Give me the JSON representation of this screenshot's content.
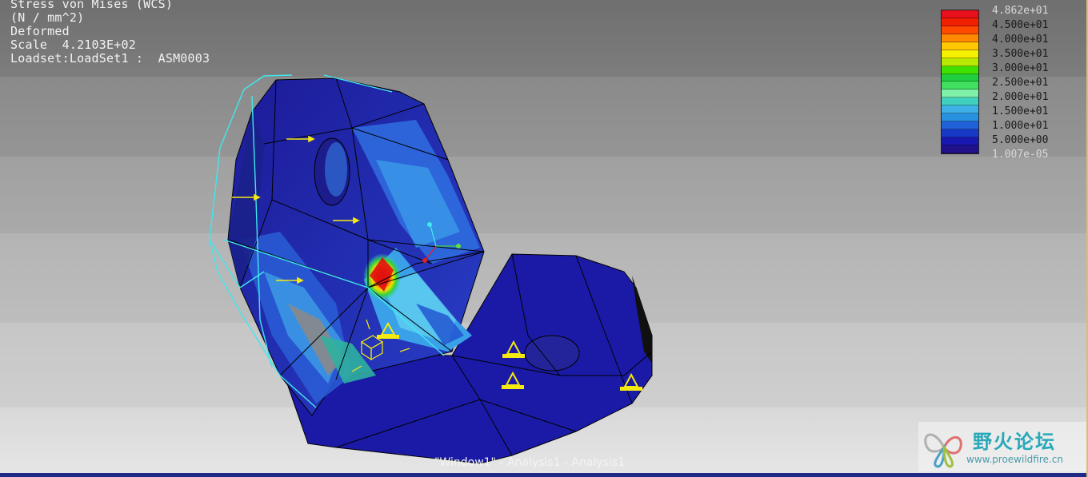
{
  "result_header": {
    "line1": "Stress von Mises (WCS)",
    "line2": "(N / mm^2)",
    "line3": "Deformed",
    "line4": "Scale  4.2103E+02",
    "line5": "Loadset:LoadSet1 :  ASM0003"
  },
  "legend": {
    "labels": [
      "4.862e+01",
      "4.500e+01",
      "4.000e+01",
      "3.500e+01",
      "3.000e+01",
      "2.500e+01",
      "2.000e+01",
      "1.500e+01",
      "1.000e+01",
      "5.000e+00",
      "1.007e-05"
    ],
    "colors": [
      "#e8101a",
      "#f02000",
      "#ff4a00",
      "#ff8a00",
      "#ffc800",
      "#f4f000",
      "#b8e800",
      "#40e000",
      "#20d040",
      "#40e060",
      "#80f0a8",
      "#40d0c0",
      "#40b0e8",
      "#2890e0",
      "#2060d8",
      "#1838c8",
      "#1818b0",
      "#20108a"
    ]
  },
  "window_caption": "\"Window1\" - Analysis1 - Analysis1",
  "watermark": {
    "title": "野火论坛",
    "url": "www.proewildfire.cn"
  },
  "colors": {
    "accent_red": "#e8101a",
    "wire_cyan": "#3fe8ee",
    "constraint_yellow": "#f4ea10",
    "mesh_blue": "#1a1aa0"
  }
}
